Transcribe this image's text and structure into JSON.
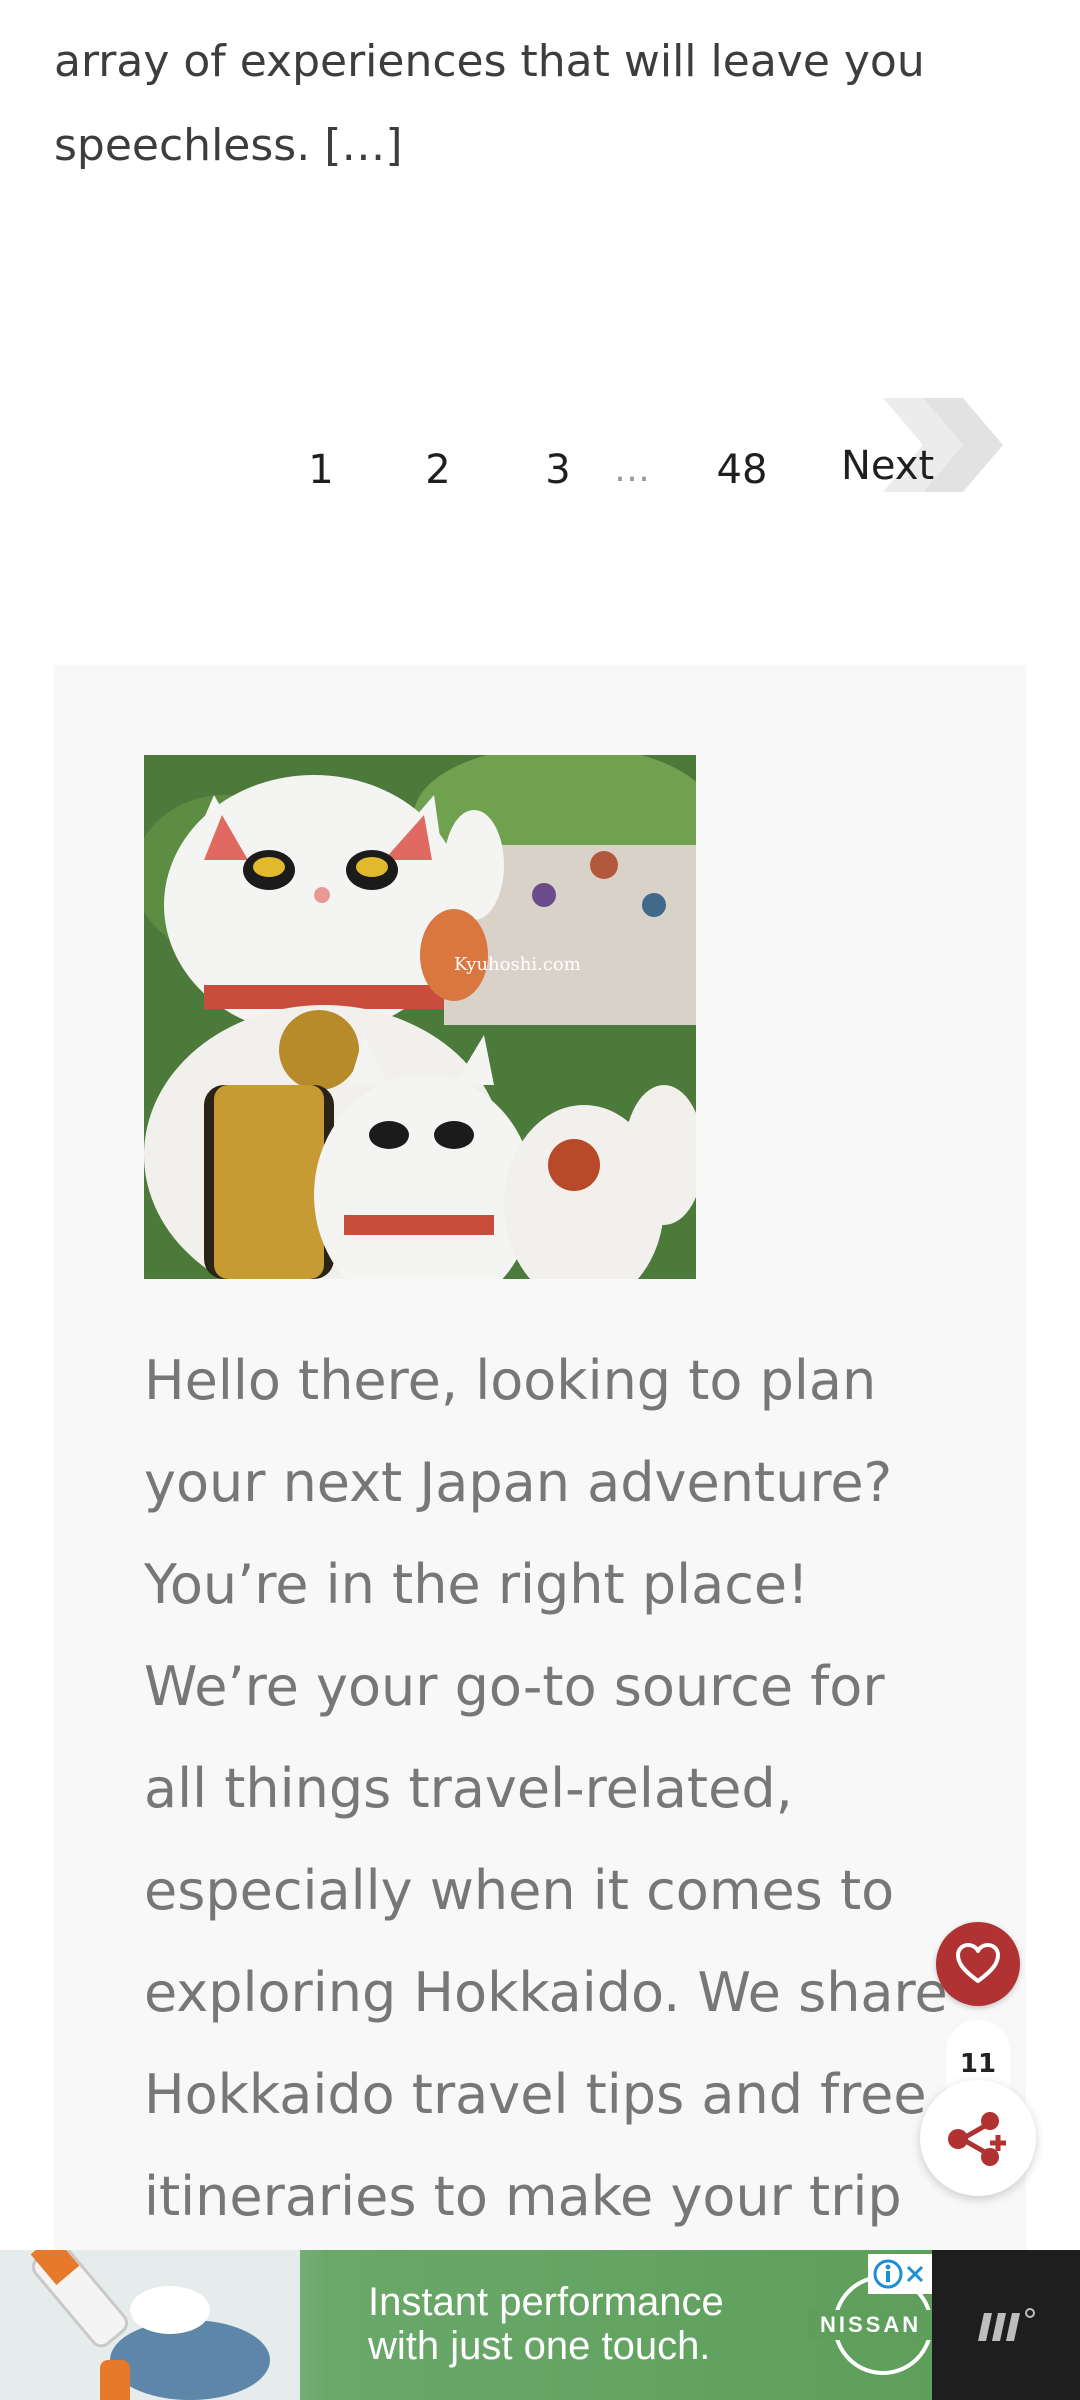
{
  "excerpt": {
    "text": "array of experiences that will leave you speechless. […]"
  },
  "pagination": {
    "pages": [
      "1",
      "2",
      "3",
      "48"
    ],
    "ellipsis": "…",
    "next_label": "Next"
  },
  "about": {
    "photo_watermark": "Kyuhoshi.com",
    "text": "Hello there, looking to plan your next Japan adventure? You’re in the right place! We’re your go-to source for all things travel-related, especially when it comes to exploring Hokkaido. We share Hokkaido travel tips and free itineraries to make your trip truly"
  },
  "floating": {
    "heart_icon": "heart-icon",
    "share_icon": "share-icon",
    "share_count": "11",
    "heart_color": "#b03232"
  },
  "ad": {
    "headline_line1": "Instant performance",
    "headline_line2": "with just one touch.",
    "brand": "NISSAN",
    "info_icon": "info-icon",
    "close_icon": "close-icon",
    "side_logo": "brand-logo-icon"
  }
}
